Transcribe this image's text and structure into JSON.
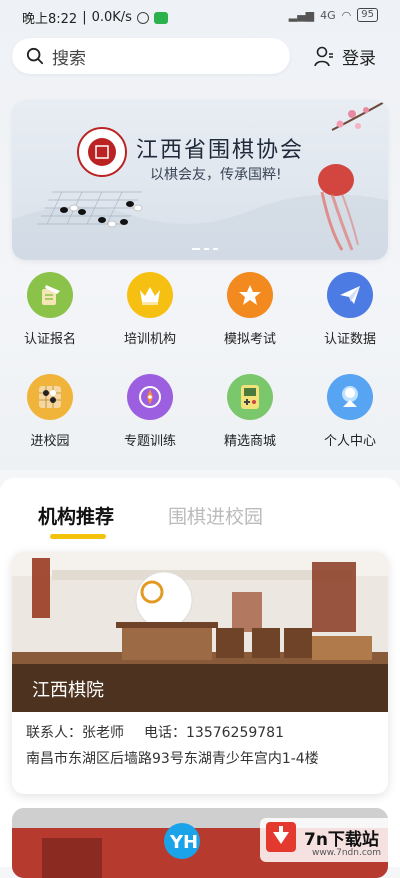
{
  "status_bar": {
    "time": "晚上8:22",
    "speed": "0.0K/s",
    "battery": "95",
    "network": "4G"
  },
  "search": {
    "placeholder": "搜索"
  },
  "header": {
    "login_label": "登录"
  },
  "banner": {
    "title": "江西省围棋协会",
    "subtitle": "以棋会友，传承国粹!"
  },
  "menu": [
    {
      "label": "认证报名",
      "icon": "exam-icon",
      "color": "#8bc34a"
    },
    {
      "label": "培训机构",
      "icon": "crown-icon",
      "color": "#f6c012"
    },
    {
      "label": "模拟考试",
      "icon": "star-icon",
      "color": "#f28a1f"
    },
    {
      "label": "认证数据",
      "icon": "paper-plane-icon",
      "color": "#4c7be3"
    },
    {
      "label": "进校园",
      "icon": "go-board-icon",
      "color": "#f1b43a"
    },
    {
      "label": "专题训练",
      "icon": "compass-icon",
      "color": "#9b5fe0"
    },
    {
      "label": "精选商城",
      "icon": "gameboy-icon",
      "color": "#7bc86c"
    },
    {
      "label": "个人中心",
      "icon": "user-icon",
      "color": "#56a4f2"
    }
  ],
  "tabs": [
    {
      "label": "机构推荐",
      "active": true
    },
    {
      "label": "围棋进校园",
      "active": false
    }
  ],
  "institution": {
    "name": "江西棋院",
    "contact_label": "联系人：张老师",
    "phone_label": "电话：13576259781",
    "address": "南昌市东湖区后墙路93号东湖青少年宫内1-4楼"
  },
  "watermark": {
    "brand": "7n下载站",
    "url": "www.7ndn.com"
  }
}
